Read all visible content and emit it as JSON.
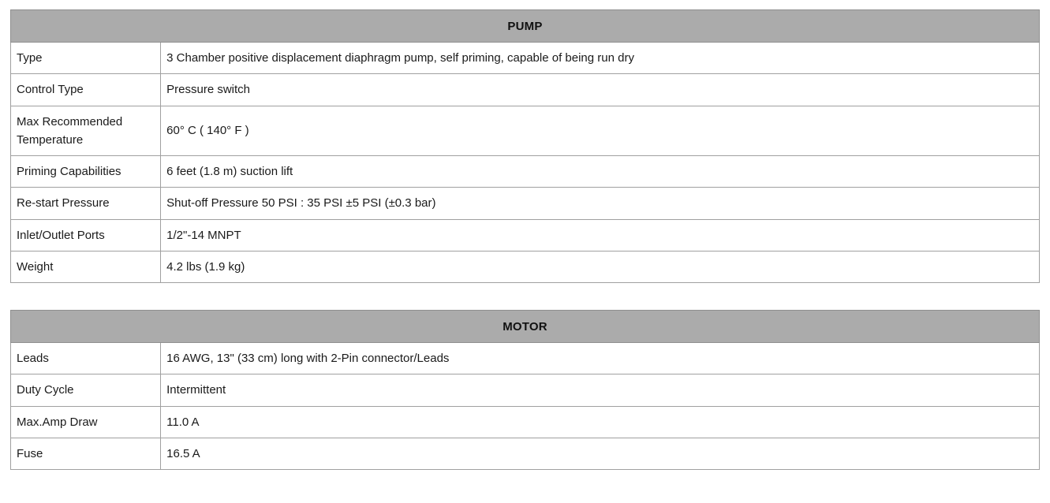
{
  "document": {
    "title": "Pump and Motor Specifications",
    "colors": {
      "section_header_bg": "#ababab",
      "section_header_text": "#111111",
      "table_border": "#8f8f8f",
      "cell_border": "#a0a0a0",
      "page_bg": "#ffffff",
      "body_text": "#1a1a1a"
    }
  },
  "tables": [
    {
      "section": "PUMP",
      "rows": [
        {
          "label": "Type",
          "value": "3 Chamber positive displacement diaphragm pump, self priming, capable of being run dry"
        },
        {
          "label": "Control Type",
          "value": "Pressure switch"
        },
        {
          "label_line1": "Max Recommended",
          "label_line2": "Temperature",
          "label": "Max Recommended Temperature",
          "value": "60° C ( 140° F )"
        },
        {
          "label": "Priming Capabilities",
          "value": "6 feet (1.8 m) suction lift"
        },
        {
          "label": "Re-start Pressure",
          "value": "Shut-off Pressure 50 PSI : 35 PSI ±5 PSI (±0.3 bar)"
        },
        {
          "label": "Inlet/Outlet Ports",
          "value": "1/2\"-14 MNPT"
        },
        {
          "label": "Weight",
          "value": "4.2 lbs (1.9 kg)"
        }
      ]
    },
    {
      "section": "MOTOR",
      "rows": [
        {
          "label": "Leads",
          "value": "16 AWG, 13\" (33 cm) long with 2-Pin connector/Leads"
        },
        {
          "label": "Duty Cycle",
          "value": "Intermittent"
        },
        {
          "label": "Max.Amp Draw",
          "value": "11.0 A"
        },
        {
          "label": "Fuse",
          "value": "16.5 A"
        }
      ]
    }
  ]
}
